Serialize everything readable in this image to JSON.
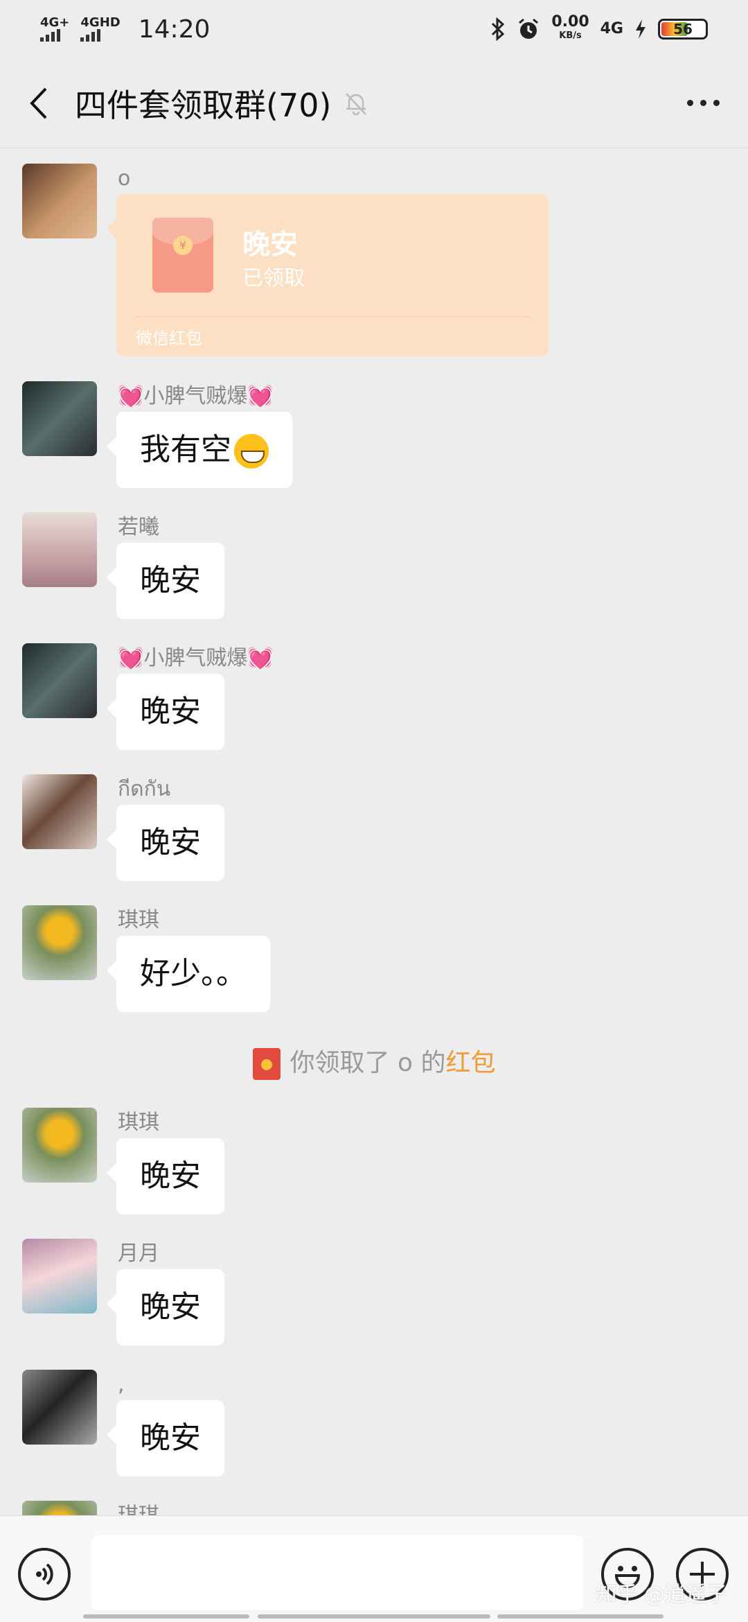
{
  "status_bar": {
    "net1": "4G+",
    "net2": "4GHD",
    "time": "14:20",
    "speed": "0.00",
    "speed_unit": "KB/s",
    "net3": "4G",
    "battery": "56"
  },
  "header": {
    "title": "四件套领取群(70)",
    "icons": [
      "back-icon",
      "mute-bell-icon",
      "more-icon"
    ]
  },
  "messages": [
    {
      "sender": "o",
      "type": "red_packet",
      "packet_title": "晚安",
      "packet_status": "已领取",
      "packet_footer": "微信红包"
    },
    {
      "sender": "小脾气贼爆",
      "type": "text",
      "text": "我有空"
    },
    {
      "sender": "若曦",
      "type": "text",
      "text": "晚安"
    },
    {
      "sender": "小脾气贼爆",
      "type": "text",
      "text": "晚安"
    },
    {
      "sender": "กีดกัน",
      "type": "text",
      "text": "晚安"
    },
    {
      "sender": "琪琪",
      "type": "text",
      "text": "好少。。"
    },
    {
      "sender": "琪琪",
      "type": "text",
      "text": "晚安"
    },
    {
      "sender": "月月",
      "type": "text",
      "text": "晚安"
    },
    {
      "sender": ",",
      "type": "text",
      "text": "晚安"
    },
    {
      "sender": "琪琪",
      "type": "partial"
    }
  ],
  "notice": {
    "prefix": "你领取了 o 的",
    "link": "红包"
  },
  "heart_glyph": "💓",
  "watermark": "知乎 @逍遥子",
  "input_bar": {
    "icons": [
      "voice-icon",
      "emoji-icon",
      "plus-icon"
    ]
  }
}
